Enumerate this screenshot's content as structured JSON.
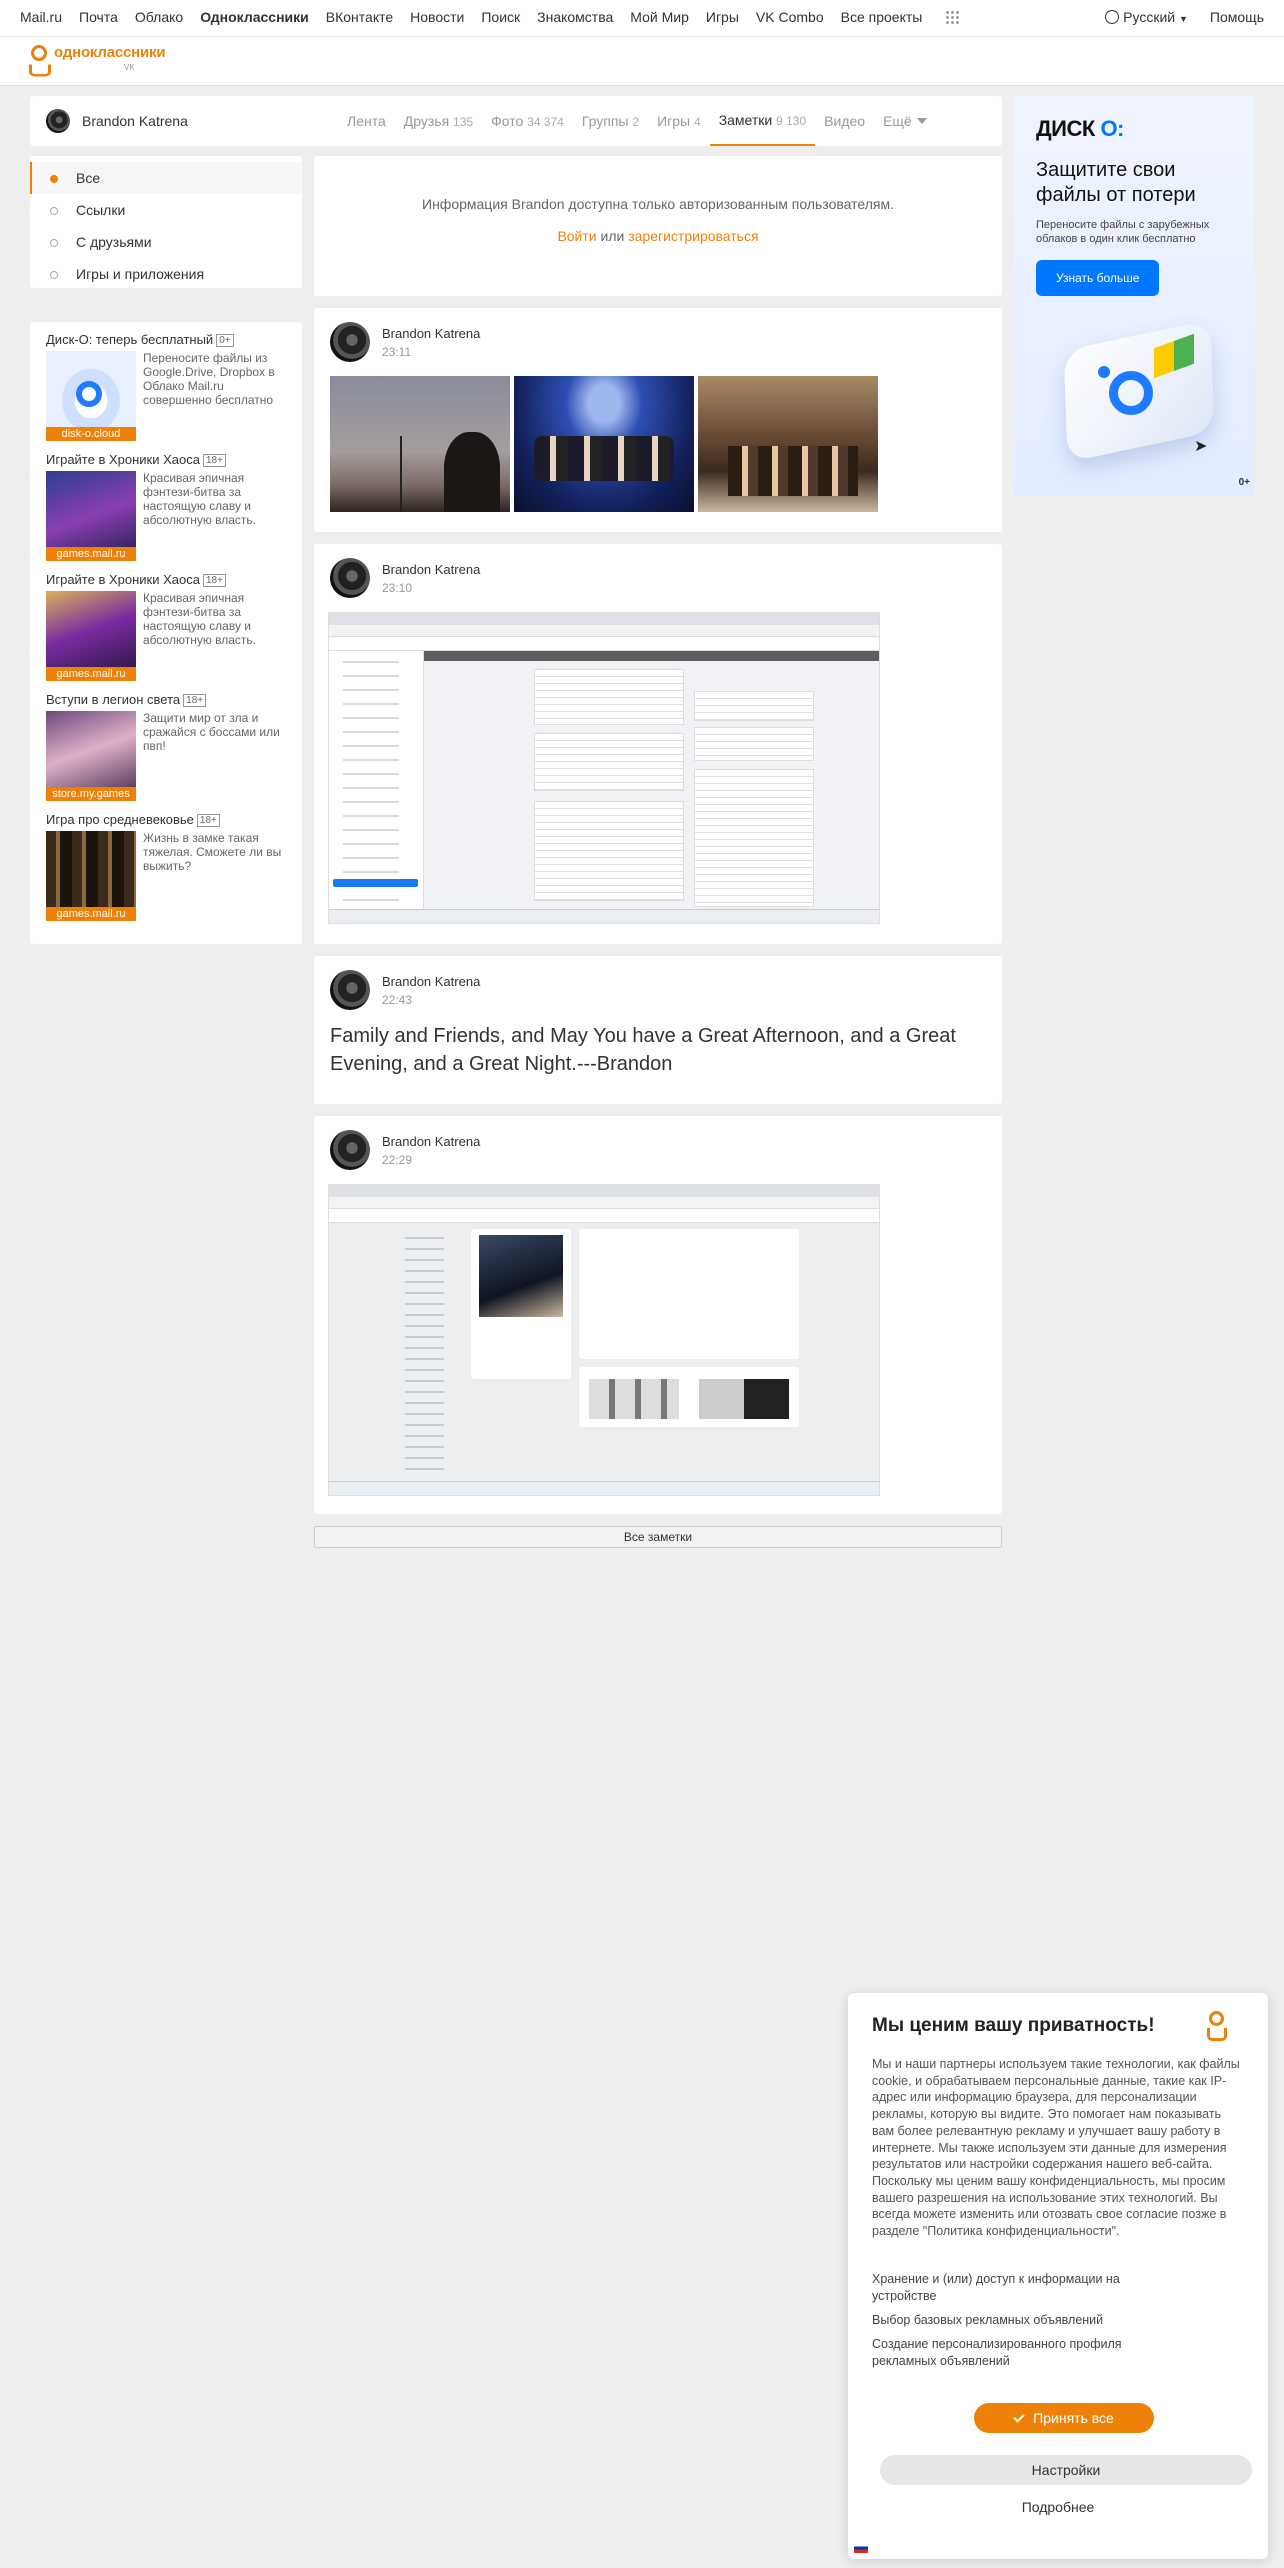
{
  "topnav": {
    "links": [
      "Mail.ru",
      "Почта",
      "Облако",
      "Одноклассники",
      "ВКонтакте",
      "Новости",
      "Поиск",
      "Знакомства",
      "Мой Мир",
      "Игры",
      "VK Combo",
      "Все проекты"
    ],
    "active_index": 3,
    "language": "Русский",
    "help": "Помощь"
  },
  "header": {
    "logo_text": "одноклассники",
    "logo_sub": "VK"
  },
  "profile": {
    "name": "Brandon Katrena",
    "tabs": [
      {
        "label": "Лента",
        "count": ""
      },
      {
        "label": "Друзья",
        "count": "135"
      },
      {
        "label": "Фото",
        "count": "34 374"
      },
      {
        "label": "Группы",
        "count": "2"
      },
      {
        "label": "Игры",
        "count": "4"
      },
      {
        "label": "Заметки",
        "count": "9 130"
      },
      {
        "label": "Видео",
        "count": ""
      },
      {
        "label": "Ещё",
        "count": ""
      }
    ],
    "active_tab": 5
  },
  "left_nav": {
    "items": [
      "Все",
      "Ссылки",
      "С друзьями",
      "Игры и приложения"
    ],
    "active_index": 0
  },
  "ads": [
    {
      "title": "Диск-О: теперь бесплатный",
      "age": "0+",
      "desc": "Переносите файлы из Google.Drive, Dropbox в Облако Mail.ru совершенно бесплатно",
      "label": "disk-o.cloud"
    },
    {
      "title": "Играйте в Хроники Хаоса",
      "age": "18+",
      "desc": "Красивая эпичная фэнтези-битва за настоящую славу и абсолютную власть.",
      "label": "games.mail.ru"
    },
    {
      "title": "Играйте в Хроники Хаоса",
      "age": "18+",
      "desc": "Красивая эпичная фэнтези-битва за настоящую славу и абсолютную власть.",
      "label": "games.mail.ru"
    },
    {
      "title": "Вступи в легион света",
      "age": "18+",
      "desc": "Защити мир от зла и сражайся с боссами или пвп!",
      "label": "store.my.games"
    },
    {
      "title": "Игра про средневековье",
      "age": "18+",
      "desc": "Жизнь в замке такая тяжелая. Сможете ли вы выжить?",
      "label": "games.mail.ru"
    }
  ],
  "info": {
    "message": "Информация Brandon доступна только авторизованным пользователям.",
    "login": "Войти",
    "or": "или",
    "register": "зарегистрироваться"
  },
  "posts": [
    {
      "author": "Brandon Katrena",
      "time": "23:11"
    },
    {
      "author": "Brandon Katrena",
      "time": "23:10"
    },
    {
      "author": "Brandon Katrena",
      "time": "22:43",
      "text": "Family and Friends,  and May You have a Great Afternoon, and a Great Evening, and a Great Night.---Brandon"
    },
    {
      "author": "Brandon Katrena",
      "time": "22:29"
    }
  ],
  "all_notes": "Все заметки",
  "promo": {
    "brand_a": "ДИСК",
    "brand_b": "О:",
    "title": "Защитите свои файлы от потери",
    "sub": "Переносите файлы с зарубежных облаков в один клик бесплатно",
    "button": "Узнать больше",
    "age": "0+"
  },
  "privacy": {
    "title": "Мы ценим вашу приватность!",
    "body": "Мы и наши партнеры используем такие технологии, как файлы cookie, и обрабатываем персональные данные, такие как IP-адрес или информацию браузера, для персонализации рекламы, которую вы видите. Это помогает нам показывать вам более релевантную рекламу и улучшает вашу работу в интернете. Мы также используем эти данные для измерения результатов или настройки содержания нашего веб-сайта. Поскольку мы ценим вашу конфиденциальность, мы просим вашего разрешения на использование этих технологий. Вы всегда можете изменить или отозвать свое согласие позже в разделе \"Политика конфиденциальности\".",
    "options": [
      "Хранение и (или) доступ к информации на устройстве",
      "Выбор базовых рекламных объявлений",
      "Создание персонализированного профиля рекламных объявлений"
    ],
    "accept": "Принять все",
    "settings": "Настройки",
    "more": "Подробнее"
  }
}
